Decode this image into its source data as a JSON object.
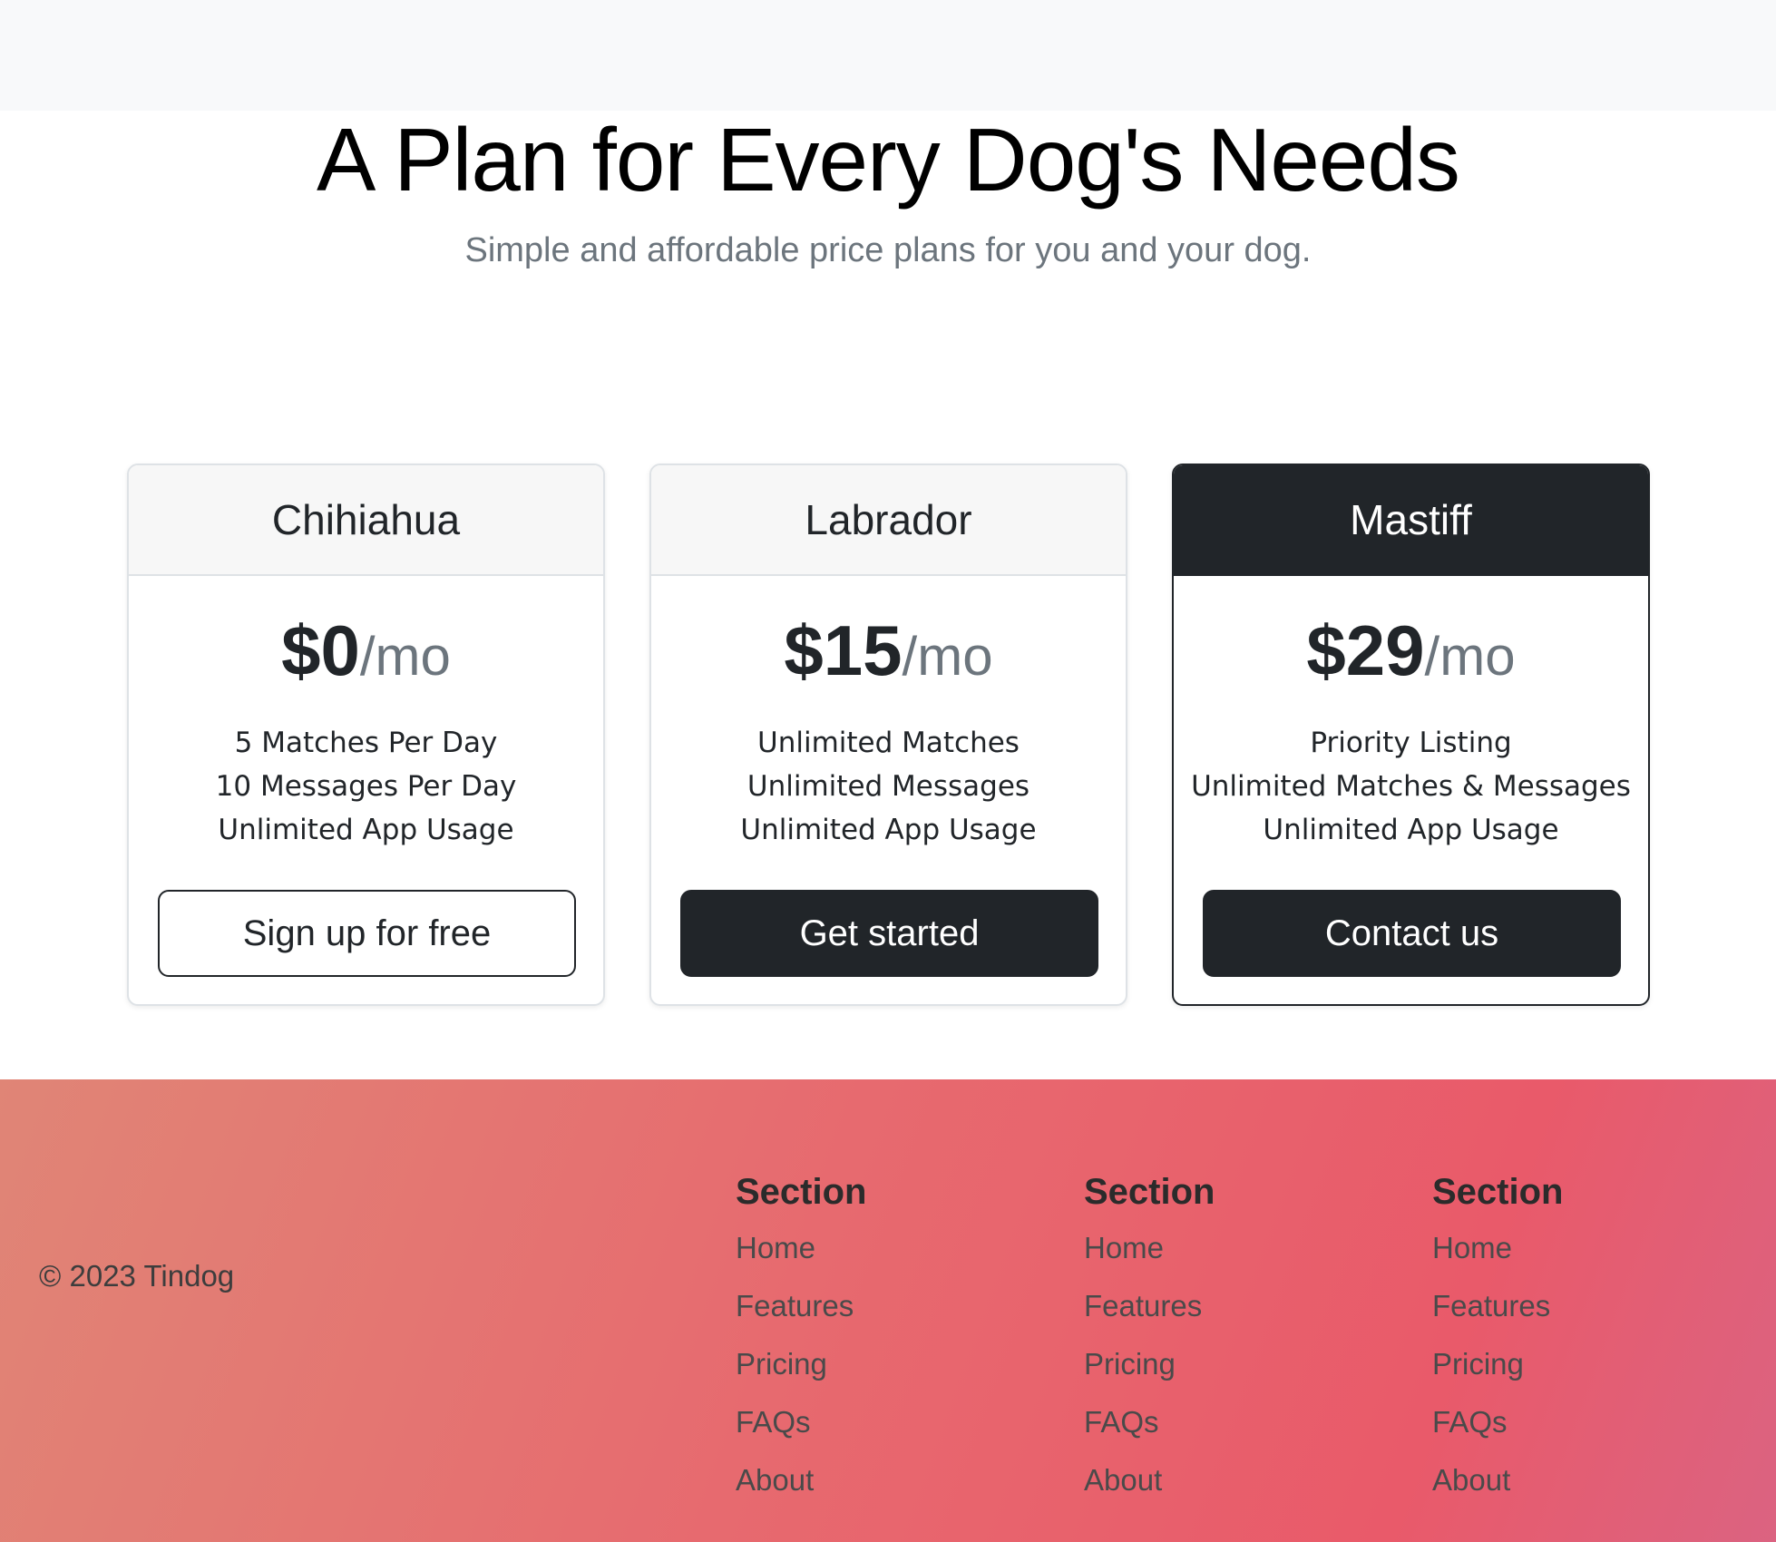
{
  "pricing": {
    "title": "A Plan for Every Dog's Needs",
    "subtitle": "Simple and affordable price plans for you and your dog.",
    "plans": [
      {
        "name": "Chihiahua",
        "price": "$0",
        "unit": "/mo",
        "features": [
          "5 Matches Per Day",
          "10 Messages Per Day",
          "Unlimited App Usage"
        ],
        "button_label": "Sign up for free"
      },
      {
        "name": "Labrador",
        "price": "$15",
        "unit": "/mo",
        "features": [
          "Unlimited Matches",
          "Unlimited Messages",
          "Unlimited App Usage"
        ],
        "button_label": "Get started"
      },
      {
        "name": "Mastiff",
        "price": "$29",
        "unit": "/mo",
        "features": [
          "Priority Listing",
          "Unlimited Matches & Messages",
          "Unlimited App Usage"
        ],
        "button_label": "Contact us"
      }
    ]
  },
  "footer": {
    "copyright": "© 2023 Tindog",
    "columns": [
      {
        "heading": "Section",
        "links": [
          "Home",
          "Features",
          "Pricing",
          "FAQs",
          "About"
        ]
      },
      {
        "heading": "Section",
        "links": [
          "Home",
          "Features",
          "Pricing",
          "FAQs",
          "About"
        ]
      },
      {
        "heading": "Section",
        "links": [
          "Home",
          "Features",
          "Pricing",
          "FAQs",
          "About"
        ]
      }
    ]
  },
  "colors": {
    "dark": "#212529",
    "muted": "#6c757d",
    "footer_gradient_start": "#e08576",
    "footer_gradient_end": "#e95a6a"
  }
}
